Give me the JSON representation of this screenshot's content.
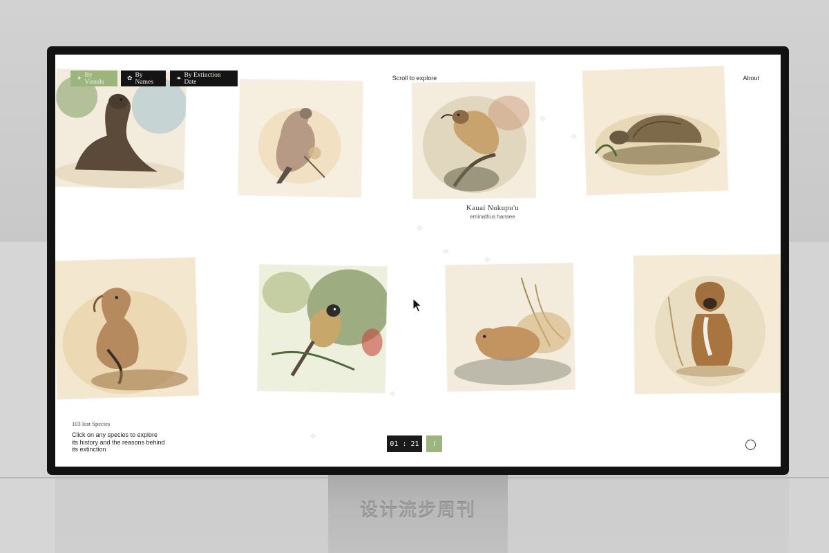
{
  "filters": [
    {
      "label": "By Visuals",
      "icon": "sparkle-icon",
      "active": true
    },
    {
      "label": "By Names",
      "icon": "gear-icon",
      "active": false
    },
    {
      "label": "By Extinction Date",
      "icon": "leaf-icon",
      "active": false
    }
  ],
  "header": {
    "scroll_hint": "Scroll to explore",
    "about_label": "About"
  },
  "featured": {
    "common_name": "Kauai Nukupu'u",
    "scientific_name": "eminathus hansee"
  },
  "species_cards": [
    {
      "icon": "sea-lion-icon"
    },
    {
      "icon": "pigeon-icon"
    },
    {
      "icon": "nukupuu-bird-icon"
    },
    {
      "icon": "tortoise-icon"
    },
    {
      "icon": "vulture-icon"
    },
    {
      "icon": "songbird-icon"
    },
    {
      "icon": "hamster-icon"
    },
    {
      "icon": "dog-icon"
    }
  ],
  "footer": {
    "count_label": "103 lost Species",
    "instruction": "Click on any species to explore its history and the reasons behind its extinction",
    "timer": "01 : 21",
    "info_label": "i"
  },
  "stand": {
    "label": "设计流步周刊"
  },
  "colors": {
    "accent_green": "#9cb47e",
    "dark_button": "#141414",
    "card_bg": "#f4ecd8"
  }
}
